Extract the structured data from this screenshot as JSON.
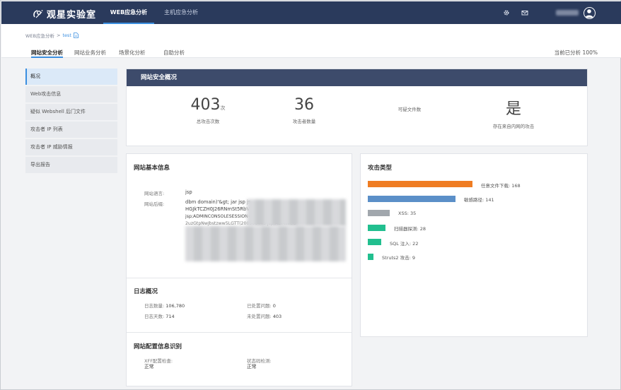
{
  "app": {
    "brand": "观星实验室",
    "nav_tabs": [
      "WEB应急分析",
      "主机应急分析"
    ]
  },
  "breadcrumb": {
    "root": "WEB应急分析",
    "separator": ">",
    "current": "test"
  },
  "sub_tabs": [
    "网站安全分析",
    "网站业务分析",
    "场景化分析",
    "自助分析"
  ],
  "progress": {
    "label": "当前已分析",
    "value": "100%"
  },
  "sidebar": {
    "items": [
      "概况",
      "Web攻击信息",
      "疑似 Webshell 后门文件",
      "攻击者 IP 列表",
      "攻击者 IP 威胁情报",
      "导出报告"
    ]
  },
  "overview": {
    "title": "网站安全概况",
    "stats": [
      {
        "value": "403",
        "unit": "次",
        "label": "总攻击次数"
      },
      {
        "value": "36",
        "unit": "",
        "label": "攻击者数量"
      },
      {
        "value": "",
        "unit": "",
        "label": "可疑文件数"
      },
      {
        "value": "是",
        "unit": "",
        "label": "存在来自内网的攻击"
      }
    ]
  },
  "basic_info": {
    "title": "网站基本信息",
    "language_label": "网站语言:",
    "language_value": "jsp",
    "backend_label": "网站后缀:",
    "backend_lines": [
      "dbm domain)'&gt; jar jsp js",
      "HGJkTCZH0J26RNmSt5RbV",
      "jsp;ADMINCONSOLESESSION=1PsyV9czZVfrXY1JdL",
      "2uzGtpNwJbstzww5LGTT(20050044S jsp;ADMINCO"
    ]
  },
  "log_overview": {
    "title": "日志概况",
    "items": [
      {
        "label": "日志数量:",
        "value": "106,780"
      },
      {
        "label": "已处置问题:",
        "value": "0"
      },
      {
        "label": "日志天数:",
        "value": "714"
      },
      {
        "label": "未处置问题:",
        "value": "403"
      }
    ]
  },
  "config": {
    "title": "网站配置信息识别",
    "items": [
      {
        "label": "XFF配置检查:",
        "value": "正常"
      },
      {
        "label": "状态码检测:",
        "value": "正常"
      }
    ]
  },
  "attack_types": {
    "title": "攻击类型",
    "bars": [
      {
        "label": "任意文件下载:",
        "value": 168,
        "color": "#ef7c22"
      },
      {
        "label": "敏感路径:",
        "value": 141,
        "color": "#5b8fc8"
      },
      {
        "label": "XSS:",
        "value": 35,
        "color": "#a1a7ad"
      },
      {
        "label": "扫描器探测:",
        "value": 28,
        "color": "#22bf8f"
      },
      {
        "label": "SQL 注入:",
        "value": 22,
        "color": "#22bf8f"
      },
      {
        "label": "Struts2 攻击:",
        "value": 9,
        "color": "#22bf8f"
      }
    ],
    "max": 168
  }
}
